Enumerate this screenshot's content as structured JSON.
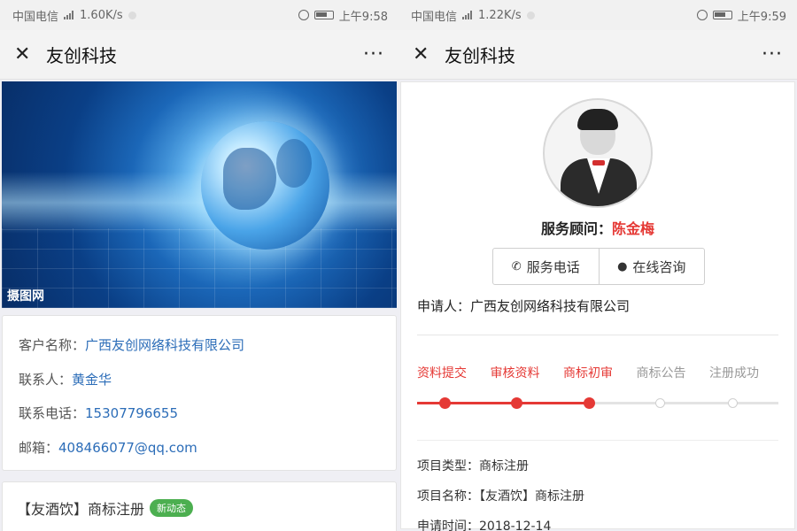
{
  "left": {
    "status": {
      "carrier": "中国电信",
      "speed": "1.60K/s",
      "time": "上午9:58"
    },
    "nav": {
      "title": "友创科技",
      "close_icon": "close-icon",
      "more": "···"
    },
    "banner": {
      "watermark": "摄图网"
    },
    "info": {
      "client_label": "客户名称：",
      "client_value": "广西友创网络科技有限公司",
      "contact_label": "联系人：",
      "contact_value": "黄金华",
      "phone_label": "联系电话：",
      "phone_value": "15307796655",
      "email_label": "邮箱：",
      "email_value": "408466077@qq.com"
    },
    "news": {
      "title": "【友酒饮】商标注册",
      "badge": "新动态"
    }
  },
  "right": {
    "status": {
      "carrier": "中国电信",
      "speed": "1.22K/s",
      "time": "上午9:59"
    },
    "nav": {
      "title": "友创科技",
      "more": "···"
    },
    "advisor": {
      "label": "服务顾问：",
      "name": "陈金梅"
    },
    "buttons": {
      "phone": "服务电话",
      "chat": "在线咨询"
    },
    "applicant": "申请人：广西友创网络科技有限公司",
    "steps": [
      {
        "label": "资料提交",
        "done": true
      },
      {
        "label": "审核资料",
        "done": true
      },
      {
        "label": "商标初审",
        "done": true
      },
      {
        "label": "商标公告",
        "done": false
      },
      {
        "label": "注册成功",
        "done": false
      }
    ],
    "details": {
      "type": "项目类型：商标注册",
      "name": "项目名称：【友酒饮】商标注册",
      "time": "申请时间：2018-12-14"
    },
    "colors": {
      "accent": "#e53935",
      "link": "#2c6db8",
      "badge": "#4caf50"
    }
  }
}
